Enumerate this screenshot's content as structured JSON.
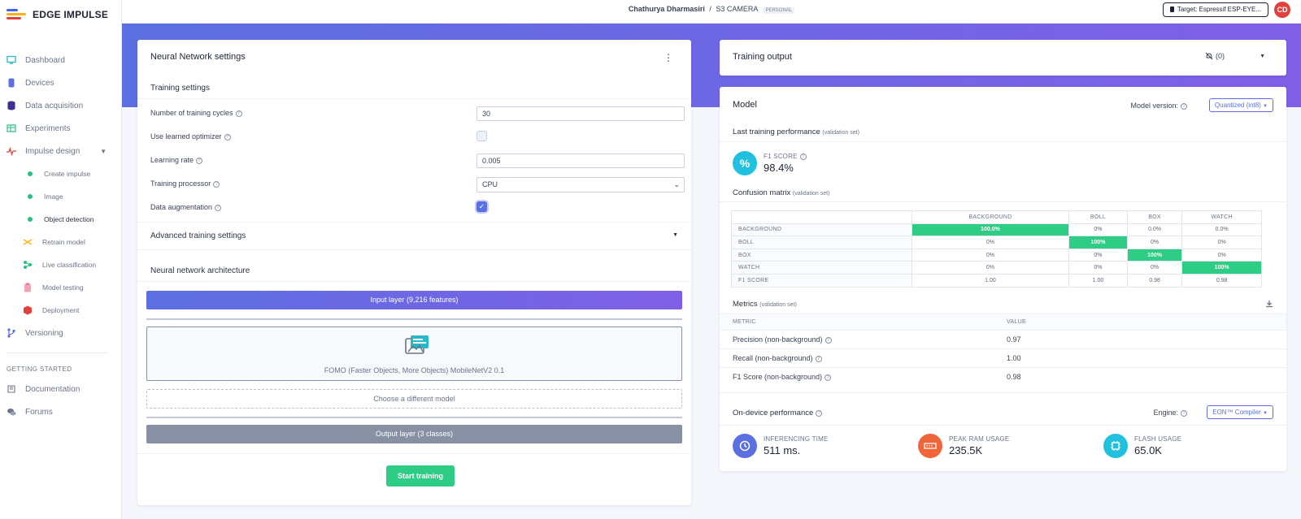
{
  "brand": {
    "name": "EDGE IMPULSE"
  },
  "sidebar": {
    "items": [
      {
        "label": "Dashboard"
      },
      {
        "label": "Devices"
      },
      {
        "label": "Data acquisition"
      },
      {
        "label": "Experiments"
      },
      {
        "label": "Impulse design"
      }
    ],
    "subitems": [
      {
        "label": "Create impulse"
      },
      {
        "label": "Image"
      },
      {
        "label": "Object detection"
      },
      {
        "label": "Retrain model"
      },
      {
        "label": "Live classification"
      },
      {
        "label": "Model testing"
      },
      {
        "label": "Deployment"
      }
    ],
    "versioning": "Versioning",
    "getting_started": "GETTING STARTED",
    "documentation": "Documentation",
    "forums": "Forums"
  },
  "topbar": {
    "user": "Chathurya Dharmasiri",
    "separator": "/",
    "project": "S3 CAMERA",
    "badge": "PERSONAL",
    "target": "Target: Espressif ESP-EYE...",
    "avatar": "CD"
  },
  "nn_settings": {
    "title": "Neural Network settings",
    "menu": "⋮",
    "training_settings": "Training settings",
    "cycles_label": "Number of training cycles",
    "cycles_value": "30",
    "optimizer_label": "Use learned optimizer",
    "lr_label": "Learning rate",
    "lr_value": "0.005",
    "processor_label": "Training processor",
    "processor_value": "CPU",
    "augmentation_label": "Data augmentation",
    "advanced": "Advanced training settings",
    "arch_title": "Neural network architecture",
    "input_layer": "Input layer (9,216 features)",
    "model_name": "FOMO (Faster Objects, More Objects) MobileNetV2 0.1",
    "choose_model": "Choose a different model",
    "output_layer": "Output layer (3 classes)",
    "start": "Start training"
  },
  "training_output": {
    "title": "Training output",
    "count": "(0)"
  },
  "model": {
    "title": "Model",
    "version_label": "Model version:",
    "version_value": "Quantized (int8)",
    "last_perf": "Last training performance",
    "validation_set": "(validation set)",
    "f1_label": "F1 SCORE",
    "f1_value": "98.4%",
    "cm_title": "Confusion matrix",
    "cm_cols": [
      "BACKGROUND",
      "BOLL",
      "BOX",
      "WATCH"
    ],
    "cm_rows": [
      {
        "label": "BACKGROUND",
        "cells": [
          "100.0%",
          "0%",
          "0.0%",
          "0.0%"
        ]
      },
      {
        "label": "BOLL",
        "cells": [
          "0%",
          "100%",
          "0%",
          "0%"
        ]
      },
      {
        "label": "BOX",
        "cells": [
          "0%",
          "0%",
          "100%",
          "0%"
        ]
      },
      {
        "label": "WATCH",
        "cells": [
          "0%",
          "0%",
          "0%",
          "100%"
        ]
      },
      {
        "label": "F1 SCORE",
        "cells": [
          "1.00",
          "1.00",
          "0.98",
          "0.98"
        ]
      }
    ],
    "metrics_title": "Metrics",
    "metric_col": "METRIC",
    "value_col": "VALUE",
    "metrics": [
      {
        "name": "Precision (non-background)",
        "value": "0.97"
      },
      {
        "name": "Recall (non-background)",
        "value": "1.00"
      },
      {
        "name": "F1 Score (non-background)",
        "value": "0.98"
      }
    ],
    "on_device": "On-device performance",
    "engine_label": "Engine:",
    "engine_value": "EON™ Compiler",
    "inferencing_label": "INFERENCING TIME",
    "inferencing_value": "511 ms.",
    "ram_label": "PEAK RAM USAGE",
    "ram_value": "235.5K",
    "flash_label": "FLASH USAGE",
    "flash_value": "65.0K"
  },
  "colors": {
    "accent": "#5b6fe0",
    "green": "#2ecc85",
    "grey_layer": "#8891a4"
  }
}
